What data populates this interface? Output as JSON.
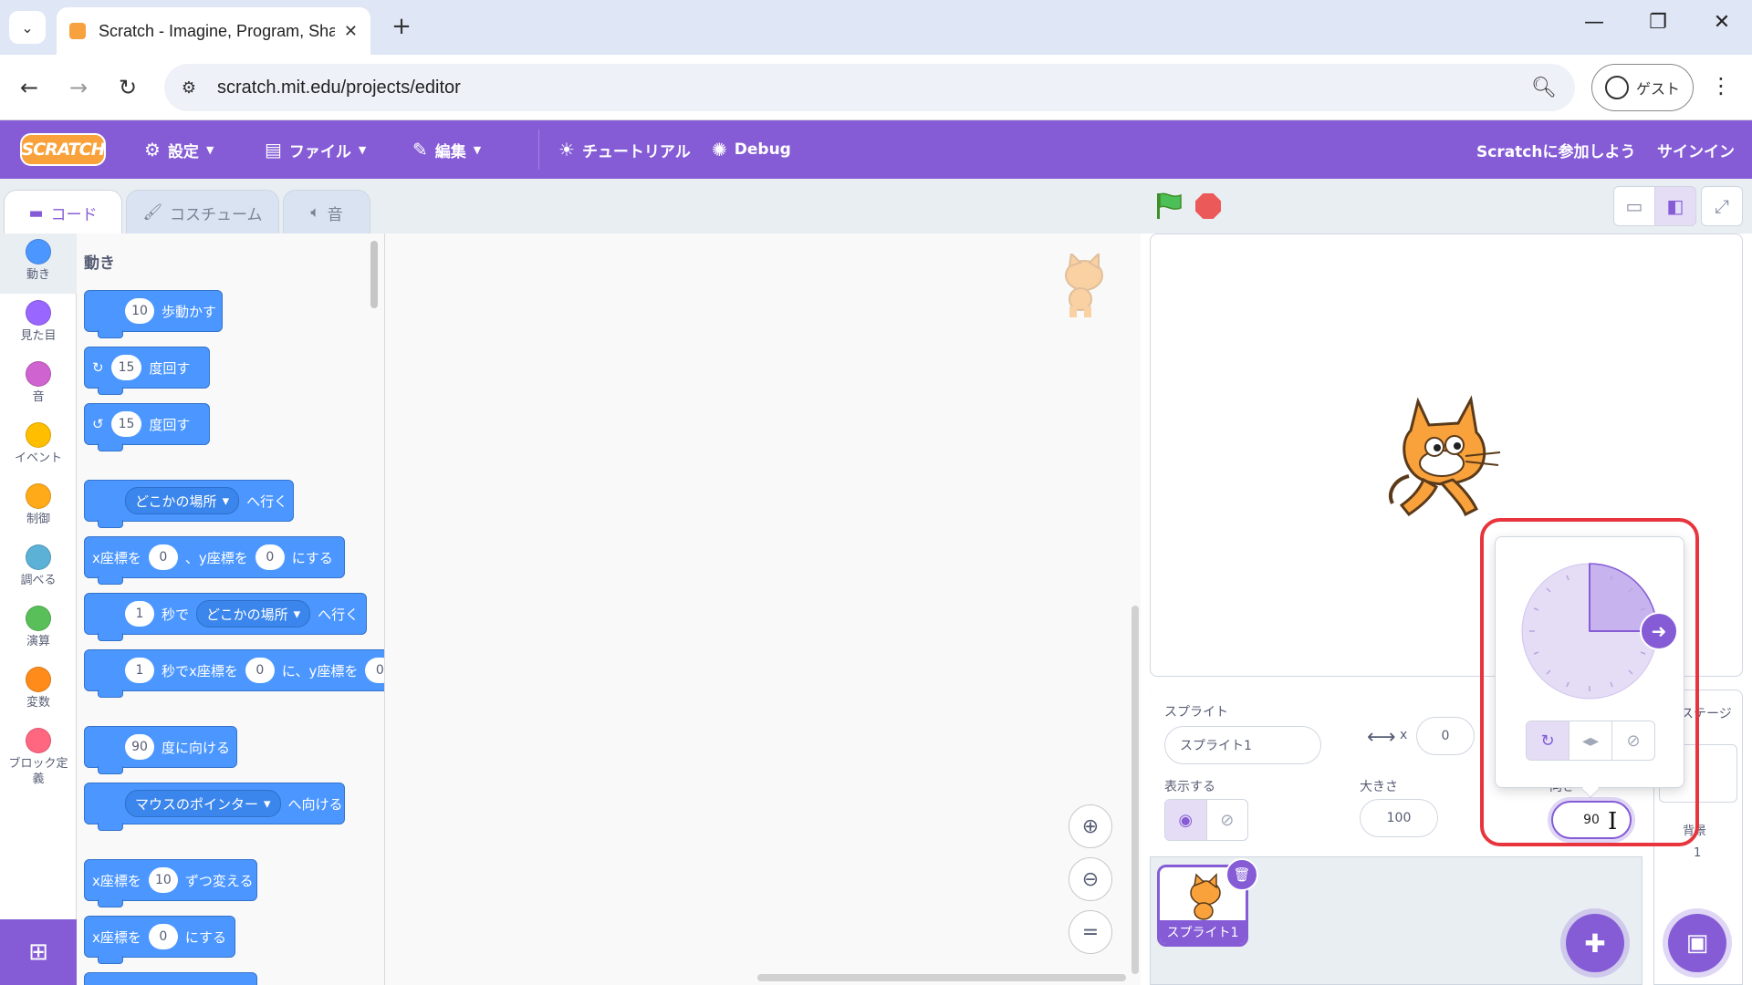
{
  "browser": {
    "tab_title": "Scratch - Imagine, Program, Sha",
    "tab_close": "✕",
    "new_tab": "+",
    "url": "scratch.mit.edu/projects/editor",
    "profile_label": "ゲスト",
    "controls": {
      "minimize": "—",
      "restore": "❐",
      "close": "✕"
    }
  },
  "menubar": {
    "logo": "SCRATCH",
    "settings": "設定",
    "file": "ファイル",
    "edit": "編集",
    "tutorials": "チュートリアル",
    "debug": "Debug",
    "join": "Scratchに参加しよう",
    "signin": "サインイン"
  },
  "editor_tabs": {
    "code": "コード",
    "costumes": "コスチューム",
    "sounds": "音"
  },
  "categories": [
    {
      "label": "動き",
      "color": "#4c97ff"
    },
    {
      "label": "見た目",
      "color": "#9966ff"
    },
    {
      "label": "音",
      "color": "#cf63cf"
    },
    {
      "label": "イベント",
      "color": "#ffbf00"
    },
    {
      "label": "制御",
      "color": "#ffab19"
    },
    {
      "label": "調べる",
      "color": "#5cb1d6"
    },
    {
      "label": "演算",
      "color": "#59c059"
    },
    {
      "label": "変数",
      "color": "#ff8c1a"
    },
    {
      "label": "ブロック定義",
      "color": "#ff6680"
    }
  ],
  "flyout": {
    "heading": "動き",
    "blocks": {
      "move": {
        "value": "10",
        "text": "歩動かす"
      },
      "turn_right": {
        "value": "15",
        "text": "度回す"
      },
      "turn_left": {
        "value": "15",
        "text": "度回す"
      },
      "goto": {
        "menu": "どこかの場所",
        "text": "へ行く"
      },
      "goto_xy": {
        "t1": "x座標を",
        "x": "0",
        "t2": "、y座標を",
        "y": "0",
        "t3": "にする"
      },
      "glide_to": {
        "secs": "1",
        "t1": "秒で",
        "menu": "どこかの場所",
        "t2": "へ行く"
      },
      "glide_xy": {
        "secs": "1",
        "t1": "秒でx座標を",
        "x": "0",
        "t2": "に、y座標を",
        "y": "0"
      },
      "point_dir": {
        "value": "90",
        "text": "度に向ける"
      },
      "point_towards": {
        "menu": "マウスのポインター",
        "text": "へ向ける"
      },
      "change_x": {
        "t1": "x座標を",
        "value": "10",
        "t2": "ずつ変える"
      },
      "set_x": {
        "t1": "x座標を",
        "value": "0",
        "t2": "にする"
      }
    }
  },
  "sprite_info": {
    "sprite_label": "スプライト",
    "sprite_name": "スプライト1",
    "x_label": "x",
    "x_value": "0",
    "show_label": "表示する",
    "size_label": "大きさ",
    "size_value": "100",
    "direction_label": "向き",
    "direction_value": "90"
  },
  "sprite_list": {
    "thumb_name": "スプライト1"
  },
  "stage_pane": {
    "title": "ステージ",
    "backdrops_label": "背景",
    "backdrops_count": "1"
  },
  "direction_popover": {
    "dial_angle_deg": 90,
    "rotation_modes": [
      "all-around",
      "left-right",
      "dont-rotate"
    ],
    "selected_mode": "all-around"
  },
  "colors": {
    "accent": "#855cd6",
    "motion": "#4c97ff",
    "highlight": "#e8343c"
  }
}
